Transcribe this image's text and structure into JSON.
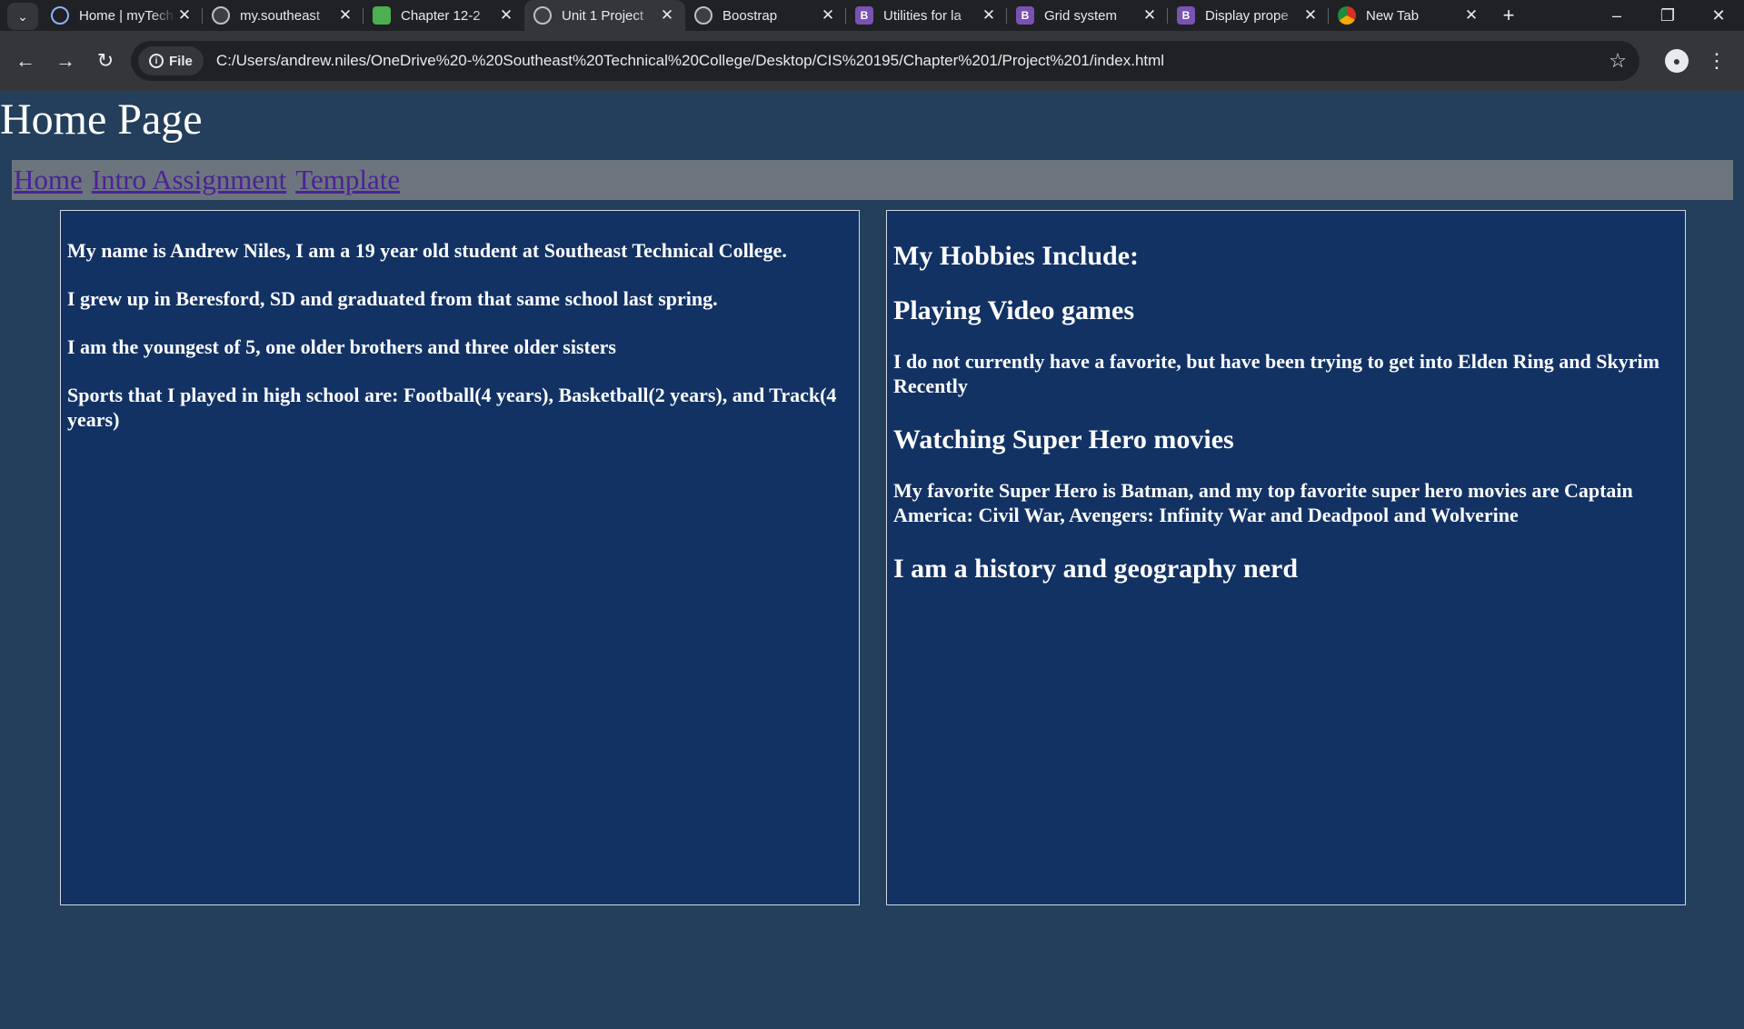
{
  "browser": {
    "tabs": [
      {
        "title": "Home | myTech",
        "icon": "progress-icon",
        "active": false
      },
      {
        "title": "my.southeast",
        "icon": "globe-icon",
        "active": false
      },
      {
        "title": "Chapter 12-2",
        "icon": "green-shield-icon",
        "active": false
      },
      {
        "title": "Unit 1 Project",
        "icon": "globe-icon",
        "active": true
      },
      {
        "title": "Boostrap",
        "icon": "globe-icon",
        "active": false
      },
      {
        "title": "Utilities for la",
        "icon": "bootstrap-icon",
        "active": false
      },
      {
        "title": "Grid system",
        "icon": "bootstrap-icon",
        "active": false
      },
      {
        "title": "Display prope",
        "icon": "bootstrap-icon",
        "active": false
      },
      {
        "title": "New Tab",
        "icon": "chrome-icon",
        "active": false
      }
    ],
    "bootstrap_glyph": "B",
    "close_glyph": "✕",
    "file_chip": "File",
    "url": "C:/Users/andrew.niles/OneDrive%20-%20Southeast%20Technical%20College/Desktop/CIS%20195/Chapter%201/Project%201/index.html"
  },
  "page": {
    "title": "Home Page",
    "nav": [
      "Home",
      "Intro Assignment",
      "Template"
    ],
    "left_column": [
      "My name is Andrew Niles, I am a 19 year old student at Southeast Technical College.",
      "I grew up in Beresford, SD and graduated from that same school last spring.",
      "I am the youngest of 5, one older brothers and three older sisters",
      "Sports that I played in high school are: Football(4 years), Basketball(2 years), and Track(4 years)"
    ],
    "right_column": {
      "heading": "My Hobbies Include:",
      "hobby1_title": "Playing Video games",
      "hobby1_text": "I do not currently have a favorite, but have been trying to get into Elden Ring and Skyrim Recently",
      "hobby2_title": "Watching Super Hero movies",
      "hobby2_text": "My favorite Super Hero is Batman, and my top favorite super hero movies are Captain America: Civil War, Avengers: Infinity War and Deadpool and Wolverine",
      "hobby3_title": "I am a history and geography nerd"
    }
  },
  "colors": {
    "page_bg": "#243f5b",
    "column_bg": "#123264",
    "navbar_bg": "#6c757d",
    "link": "#4b2396"
  }
}
